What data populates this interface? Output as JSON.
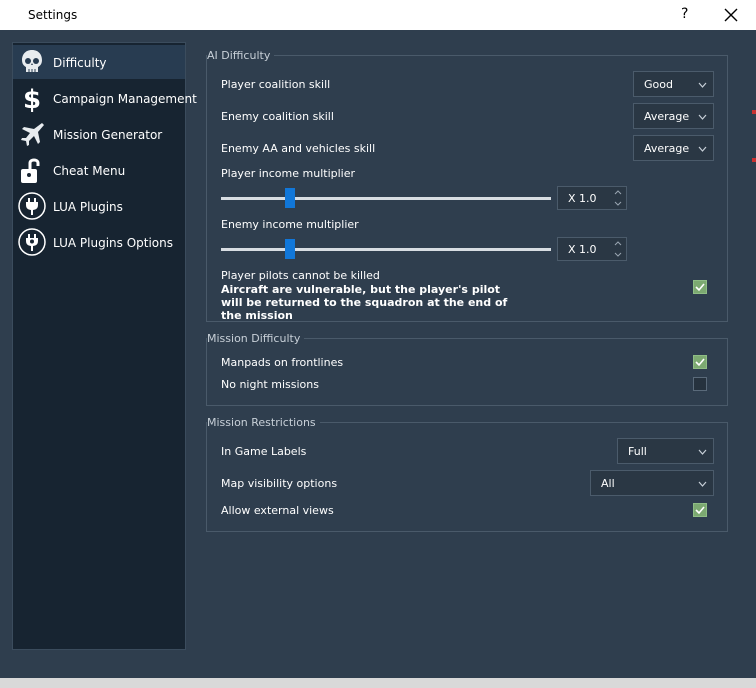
{
  "window": {
    "title": "Settings",
    "help_glyph": "?"
  },
  "sidebar": {
    "items": [
      {
        "label": "Difficulty",
        "icon": "skull-icon",
        "active": true
      },
      {
        "label": "Campaign Management",
        "icon": "dollar-icon",
        "active": false
      },
      {
        "label": "Mission Generator",
        "icon": "jet-icon",
        "active": false
      },
      {
        "label": "Cheat Menu",
        "icon": "unlocked-padlock-icon",
        "active": false
      },
      {
        "label": "LUA Plugins",
        "icon": "plug-icon",
        "active": false
      },
      {
        "label": "LUA Plugins Options",
        "icon": "plug-options-icon",
        "active": false
      }
    ]
  },
  "ai_difficulty": {
    "title": "AI Difficulty",
    "player_skill": {
      "label": "Player coalition skill",
      "value": "Good"
    },
    "enemy_skill": {
      "label": "Enemy coalition skill",
      "value": "Average"
    },
    "enemy_aa_skill": {
      "label": "Enemy AA and vehicles skill",
      "value": "Average"
    },
    "player_income": {
      "label": "Player income multiplier",
      "value": "X 1.0",
      "slider_fraction": 0.21
    },
    "enemy_income": {
      "label": "Enemy income multiplier",
      "value": "X 1.0",
      "slider_fraction": 0.21
    },
    "invulnerable": {
      "label": "Player pilots cannot be killed",
      "description": "Aircraft are vulnerable, but the player's pilot will be returned to the squadron at the end of the mission",
      "checked": true
    }
  },
  "mission_difficulty": {
    "title": "Mission Difficulty",
    "manpads": {
      "label": "Manpads on frontlines",
      "checked": true
    },
    "no_night": {
      "label": "No night missions",
      "checked": false
    }
  },
  "mission_restrictions": {
    "title": "Mission Restrictions",
    "labels": {
      "label": "In Game Labels",
      "value": "Full"
    },
    "map_visibility": {
      "label": "Map visibility options",
      "value": "All"
    },
    "external_views": {
      "label": "Allow external views",
      "checked": true
    }
  },
  "colors": {
    "background": "#2f3e4e",
    "sidebar": "#172431",
    "active_item": "#283c51",
    "slider_handle": "#1177d9",
    "checkbox_on": "#7ca971"
  }
}
